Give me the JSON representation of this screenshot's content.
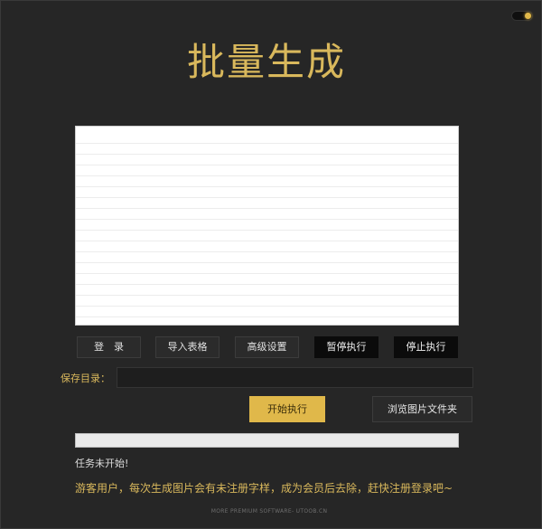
{
  "app": {
    "title": "批量生成"
  },
  "toggle": {
    "state": "on",
    "accent": "#e0b84a"
  },
  "list_panel": {
    "rows": []
  },
  "toolbar": {
    "login_label": "登　录",
    "import_label": "导入表格",
    "settings_label": "高级设置",
    "pause_label": "暂停执行",
    "stop_label": "停止执行"
  },
  "save_dir": {
    "label": "保存目录：",
    "value": ""
  },
  "actions": {
    "start_label": "开始执行",
    "browse_label": "浏览图片文件夹"
  },
  "progress": {
    "value": 0
  },
  "status": {
    "text": "任务未开始!"
  },
  "notice": {
    "text": "游客用户，每次生成图片会有未注册字样，成为会员后去除，赶快注册登录吧~"
  },
  "footer": {
    "text": "MORE PREMIUM SOFTWARE- UTOOB.CN"
  },
  "colors": {
    "accent": "#e0b84a",
    "title": "#d9b85c",
    "background": "#262626"
  }
}
